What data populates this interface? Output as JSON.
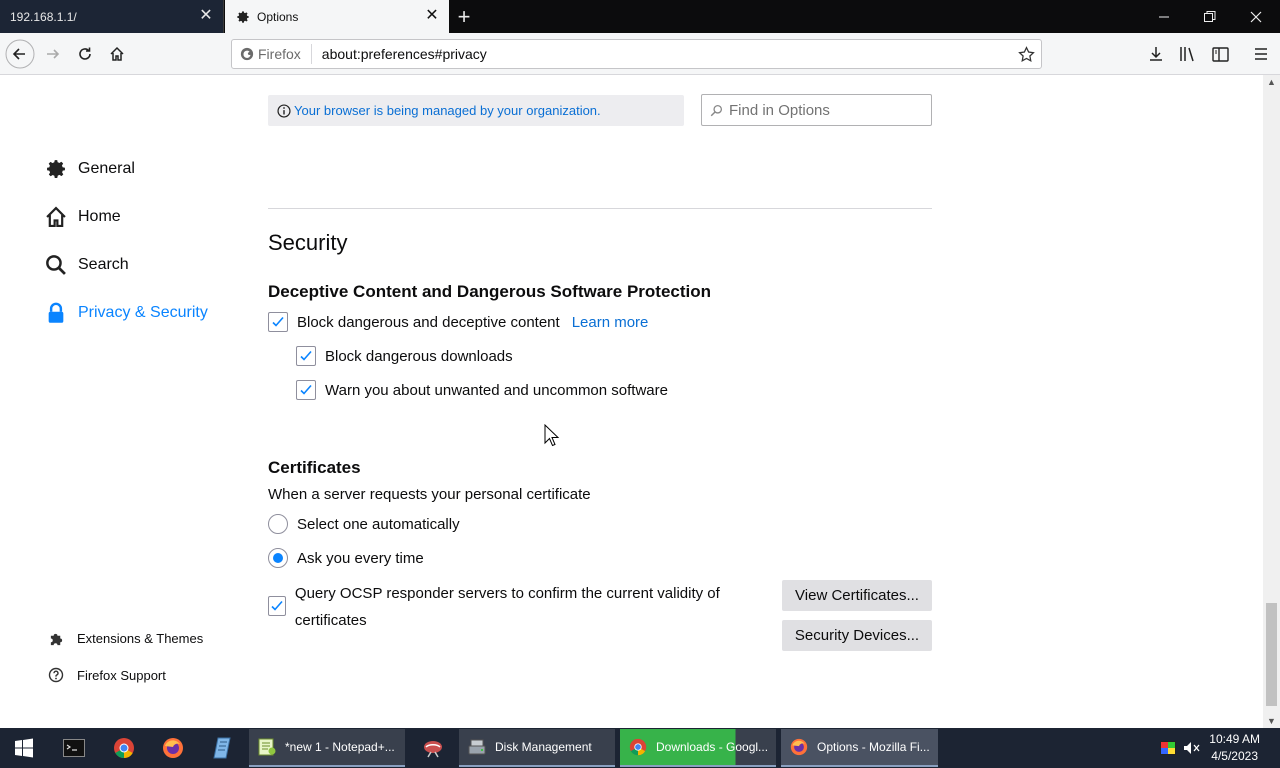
{
  "browser": {
    "tabs": [
      {
        "title": "192.168.1.1/",
        "active": false
      },
      {
        "title": "Options",
        "active": true
      }
    ],
    "identity_label": "Firefox",
    "url": "about:preferences#privacy"
  },
  "sidebar": {
    "items": [
      {
        "label": "General",
        "icon": "gear-icon",
        "selected": false
      },
      {
        "label": "Home",
        "icon": "home-icon",
        "selected": false
      },
      {
        "label": "Search",
        "icon": "search-icon",
        "selected": false
      },
      {
        "label": "Privacy & Security",
        "icon": "lock-icon",
        "selected": true
      }
    ],
    "footer": [
      {
        "label": "Extensions & Themes",
        "icon": "puzzle-icon"
      },
      {
        "label": "Firefox Support",
        "icon": "help-icon"
      }
    ]
  },
  "banner": {
    "policy_text": "Your browser is being managed by your organization."
  },
  "find": {
    "placeholder": "Find in Options"
  },
  "security": {
    "title": "Security",
    "deceptive": {
      "heading": "Deceptive Content and Dangerous Software Protection",
      "block_label": "Block dangerous and deceptive content",
      "block_checked": true,
      "learn_more": "Learn more",
      "downloads_label": "Block dangerous downloads",
      "downloads_checked": true,
      "unwanted_label": "Warn you about unwanted and uncommon software",
      "unwanted_checked": true
    },
    "certificates": {
      "heading": "Certificates",
      "description": "When a server requests your personal certificate",
      "option_auto": "Select one automatically",
      "option_ask": "Ask you every time",
      "selected_option": "ask",
      "ocsp_label": "Query OCSP responder servers to confirm the current validity of certificates",
      "ocsp_checked": true,
      "view_button": "View Certificates...",
      "devices_button": "Security Devices..."
    }
  },
  "taskbar": {
    "apps": [
      {
        "label": "*new 1 - Notepad+...",
        "icon": "notepad-plus-icon"
      },
      {
        "label": "Disk Management",
        "icon": "disk-management-icon"
      },
      {
        "label": "Downloads - Googl...",
        "icon": "chrome-icon"
      },
      {
        "label": "Options - Mozilla Fi...",
        "icon": "firefox-icon"
      }
    ],
    "time": "10:49 AM",
    "date": "4/5/2023"
  },
  "colors": {
    "accent": "#0a84ff",
    "link": "#0a6fd4",
    "taskbar": "#1c2433"
  }
}
